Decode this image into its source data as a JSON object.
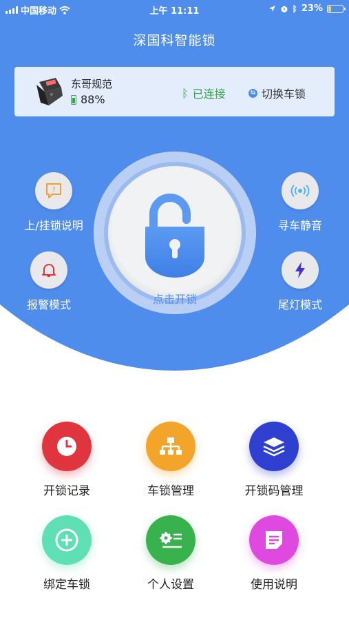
{
  "status_bar": {
    "carrier": "中国移动",
    "time": "上午 11:11",
    "battery_percent": "23%",
    "battery_level": 0.23,
    "battery_fill_color": "#f5d63b"
  },
  "header": {
    "title": "深国科智能锁"
  },
  "device": {
    "name": "东哥规范",
    "battery": "88%",
    "connection_status": "已连接",
    "switch_label": "切换车锁",
    "connected_color": "#37a04a"
  },
  "side_buttons": {
    "left_top": {
      "label": "上/挂锁说明",
      "icon": "question-bubble-icon"
    },
    "left_bottom": {
      "label": "报警模式",
      "icon": "bell-icon"
    },
    "right_top": {
      "label": "寻车静音",
      "icon": "radar-signal-icon"
    },
    "right_bottom": {
      "label": "尾灯模式",
      "icon": "lightning-icon"
    }
  },
  "lock": {
    "label": "点击开锁",
    "state": "unlocked",
    "icon": "open-padlock-icon"
  },
  "menu": [
    {
      "label": "开锁记录",
      "icon": "clock-icon",
      "color": "#e0343f"
    },
    {
      "label": "车锁管理",
      "icon": "org-chart-icon",
      "color": "#f3a42a"
    },
    {
      "label": "开锁码管理",
      "icon": "layers-icon",
      "color": "#2f3fcf"
    },
    {
      "label": "绑定车锁",
      "icon": "plus-circle-icon",
      "color": "#5ee0b4"
    },
    {
      "label": "个人设置",
      "icon": "settings-list-icon",
      "color": "#37b24d"
    },
    {
      "label": "使用说明",
      "icon": "document-icon",
      "color": "#e049e0"
    }
  ],
  "colors": {
    "primary": "#4f8ded",
    "card_bg": "#e3edfb"
  }
}
